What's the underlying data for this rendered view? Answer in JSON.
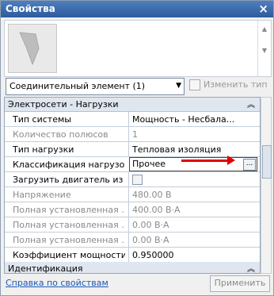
{
  "window": {
    "title": "Свойства",
    "close_glyph": "×"
  },
  "type_selector": {
    "value": "Соединительный элемент (1)",
    "edit_type_label": "Изменить тип"
  },
  "sections": [
    {
      "title": "Электросети - Нагрузки"
    },
    {
      "title": "Идентификация"
    }
  ],
  "rows": [
    {
      "name": "Тип системы",
      "value": "Мощность - Несбала..."
    },
    {
      "name": "Количество полюсов",
      "value": "1"
    },
    {
      "name": "Тип нагрузки",
      "value": "Тепловая изоляция"
    },
    {
      "name": "Классификация нагрузок",
      "value": "Прочее"
    },
    {
      "name": "Загрузить двигатель из ...",
      "value": ""
    },
    {
      "name": "Напряжение",
      "value": "480.00 В"
    },
    {
      "name": "Полная установленная ...",
      "value": "400.00 В·А"
    },
    {
      "name": "Полная установленная ...",
      "value": "0.00 В·А"
    },
    {
      "name": "Полная установленная ...",
      "value": "0.00 В·А"
    },
    {
      "name": "Коэффициент мощности",
      "value": "0.950000"
    }
  ],
  "footer": {
    "help_link": "Справка по свойствам",
    "apply_label": "Применить"
  },
  "colors": {
    "annotation_arrow": "#e00000",
    "titlebar": "#2d5b9d"
  }
}
